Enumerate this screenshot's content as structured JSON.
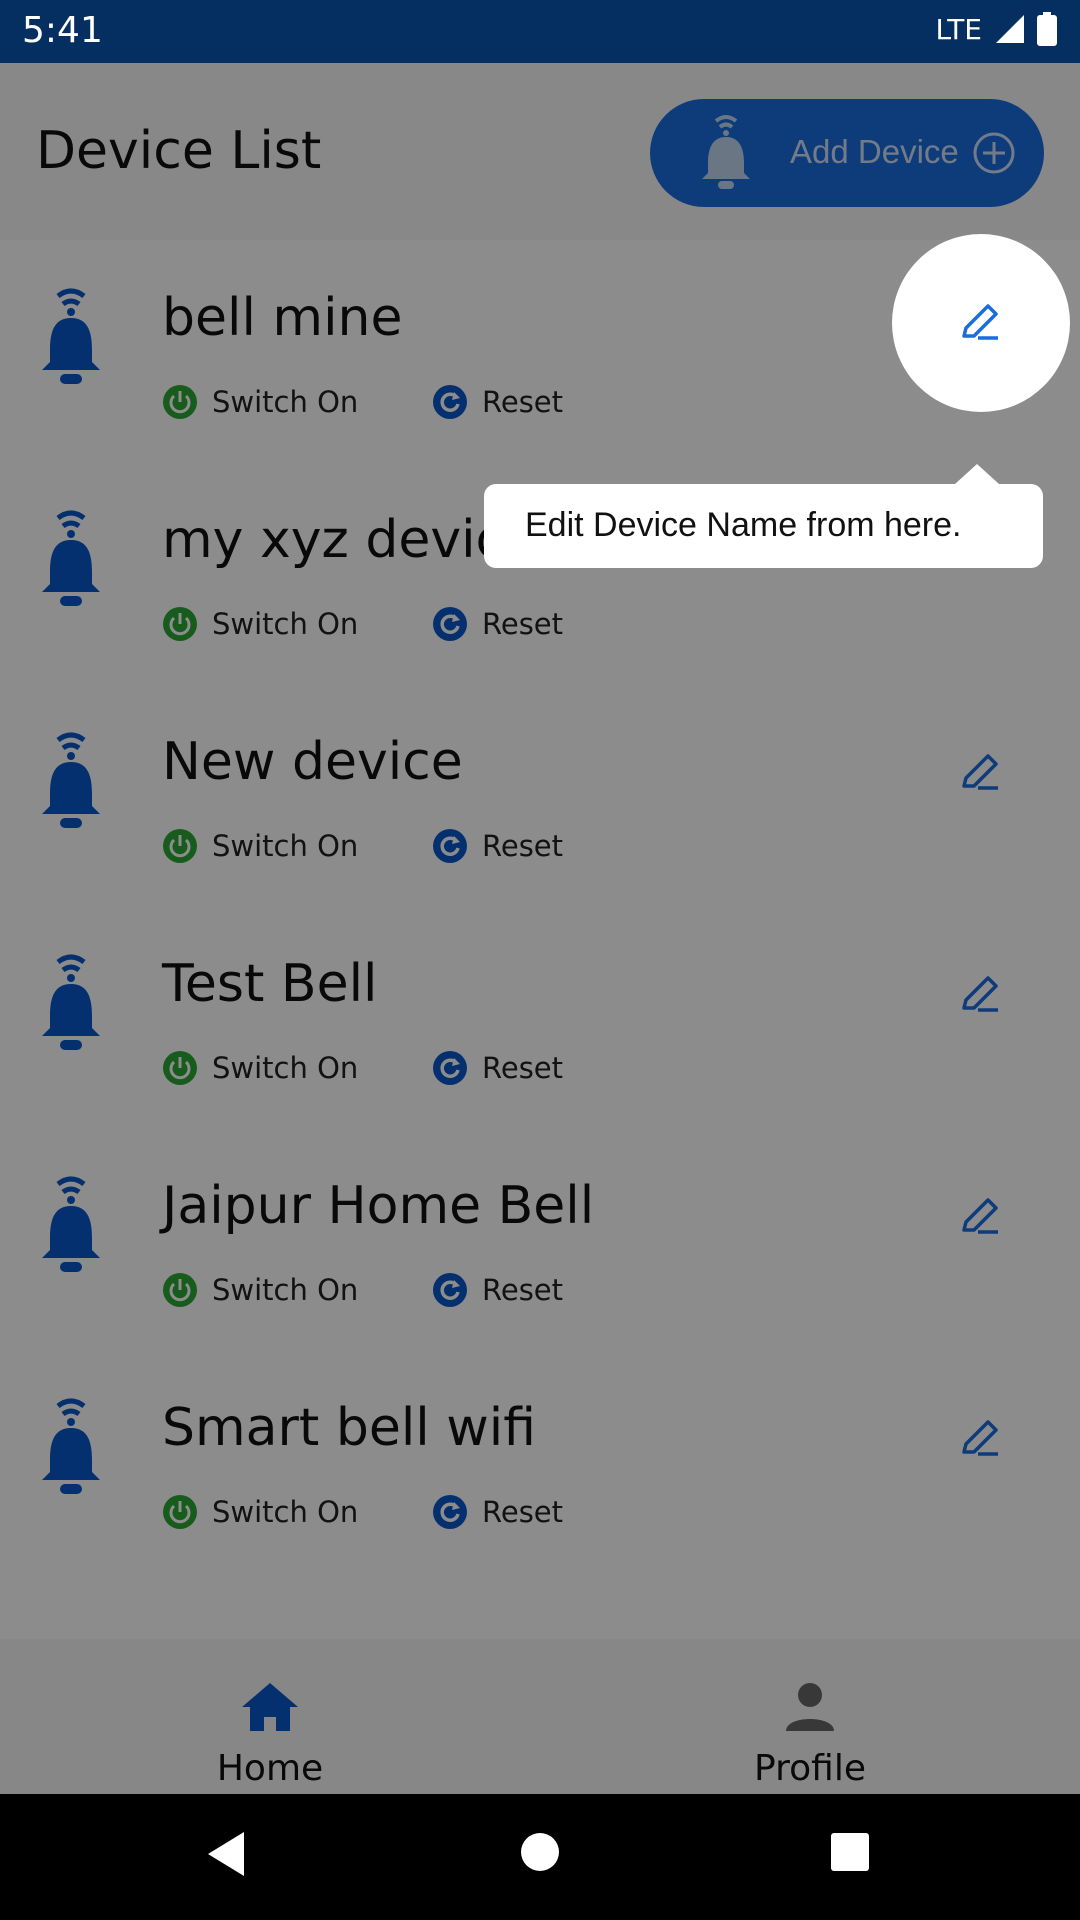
{
  "status_bar": {
    "time": "5:41",
    "network": "LTE"
  },
  "header": {
    "title": "Device List",
    "add_button_label": "Add Device"
  },
  "devices": [
    {
      "name": "bell mine",
      "switch_label": "Switch On",
      "reset_label": "Reset"
    },
    {
      "name": "my xyz device",
      "switch_label": "Switch On",
      "reset_label": "Reset"
    },
    {
      "name": "New device",
      "switch_label": "Switch On",
      "reset_label": "Reset"
    },
    {
      "name": "Test Bell",
      "switch_label": "Switch On",
      "reset_label": "Reset"
    },
    {
      "name": "Jaipur Home Bell",
      "switch_label": "Switch On",
      "reset_label": "Reset"
    },
    {
      "name": "Smart bell wifi",
      "switch_label": "Switch On",
      "reset_label": "Reset"
    }
  ],
  "tooltip": {
    "text": "Edit Device Name from here."
  },
  "bottom_nav": {
    "home_label": "Home",
    "profile_label": "Profile"
  },
  "icons": {
    "bell": "bell-wifi-icon",
    "switch": "power-icon",
    "reset": "reset-icon",
    "edit": "pencil-icon",
    "home": "home-icon",
    "profile": "person-icon",
    "add": "plus-circle-icon"
  },
  "colors": {
    "brand_blue": "#1a6de0",
    "status_bar": "#052f60",
    "switch_green": "#2aa836",
    "bell_blue": "#0a58ca"
  }
}
